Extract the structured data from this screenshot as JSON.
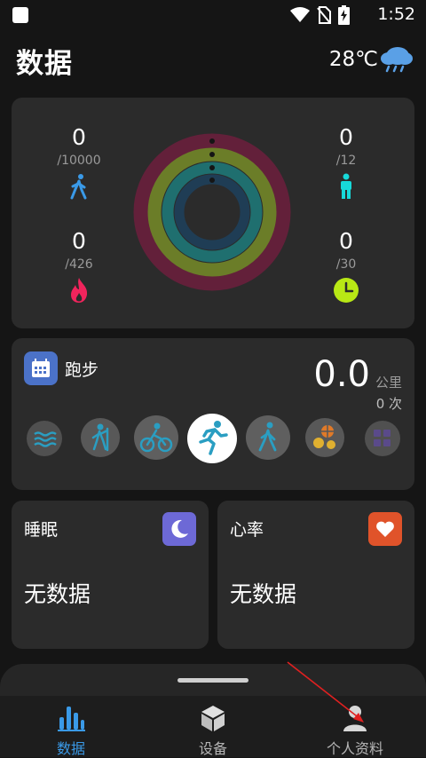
{
  "status_bar": {
    "time": "1:52"
  },
  "header": {
    "title": "数据",
    "temperature": "28℃"
  },
  "rings": {
    "steps": {
      "value": "0",
      "goal": "/10000"
    },
    "stand": {
      "value": "0",
      "goal": "/12"
    },
    "calories": {
      "value": "0",
      "goal": "/426"
    },
    "exercise": {
      "value": "0",
      "goal": "/30"
    },
    "colors": {
      "outer": "#63203a",
      "second": "#6b7d28",
      "third": "#1f6f6f",
      "inner": "#1f3d55"
    }
  },
  "running": {
    "label": "跑步",
    "distance": "0.0",
    "unit": "公里",
    "count": "0 次",
    "sports": [
      "swimming-icon",
      "elliptical-icon",
      "cycling-icon",
      "running-icon",
      "walking-icon",
      "ball-games-icon",
      "more-sports-icon"
    ],
    "selected_sport": "running-icon"
  },
  "sleep": {
    "title": "睡眠",
    "status": "无数据",
    "badge_color": "#6d69d6"
  },
  "heart_rate": {
    "title": "心率",
    "status": "无数据",
    "badge_color": "#e0532a"
  },
  "bottom_nav": {
    "items": [
      {
        "label": "数据",
        "icon": "chart-bars-icon",
        "active": true
      },
      {
        "label": "设备",
        "icon": "cube-icon",
        "active": false
      },
      {
        "label": "个人资料",
        "icon": "person-icon",
        "active": false
      }
    ],
    "accent": "#3a9ae8"
  }
}
